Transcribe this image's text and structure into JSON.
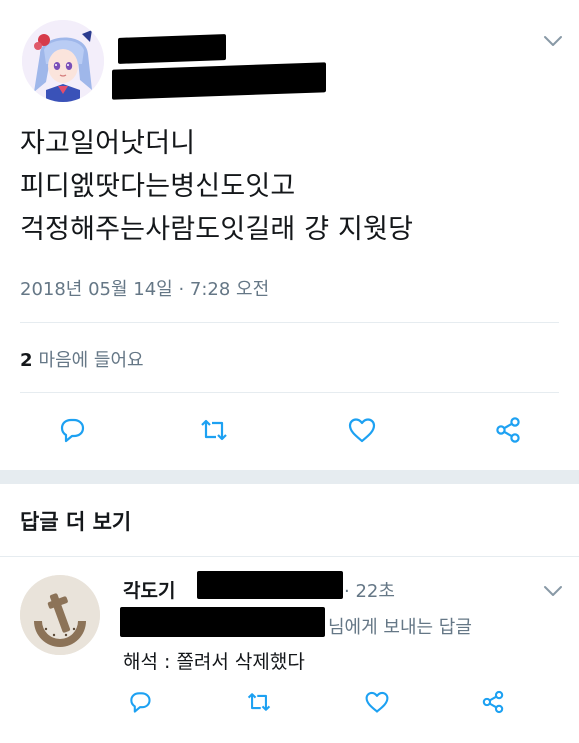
{
  "tweet": {
    "text_lines": [
      "자고일어낫더니",
      "피디엜땃다는병신도잇고",
      "걱정해주는사람도잇길래 걍 지웟당"
    ],
    "timestamp": "2018년 05월 14일 · 7:28 오전",
    "likes_count": "2",
    "likes_label": "마음에 들어요"
  },
  "actions": [
    "reply-icon",
    "retweet-icon",
    "heart-icon",
    "share-icon"
  ],
  "more_replies": {
    "header": "답글 더 보기"
  },
  "reply": {
    "name": "각도기",
    "time": "· 22초",
    "reply_to": "님에게 보내는 답글",
    "text": "해석 : 쫄려서 삭제했다"
  },
  "colors": {
    "text": "#14171a",
    "muted": "#657786",
    "divider": "#e6ecf0",
    "icon": "#1da1f2"
  }
}
